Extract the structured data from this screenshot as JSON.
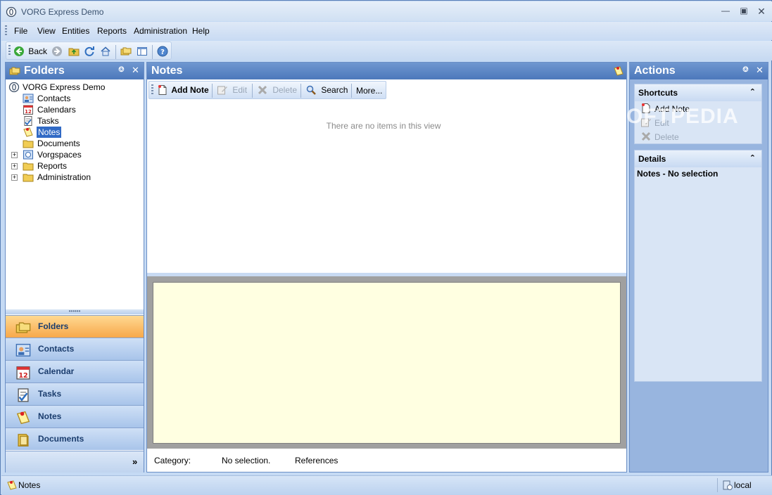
{
  "window": {
    "title": "VORG Express Demo",
    "controls": [
      "minimize",
      "maximize",
      "close"
    ]
  },
  "menu": {
    "items": [
      "File",
      "View",
      "Entities",
      "Reports",
      "Administration",
      "Help"
    ]
  },
  "toolbar": {
    "back_label": "Back",
    "icons": [
      "back-icon",
      "forward-icon",
      "folder-up-icon",
      "refresh-icon",
      "home-icon",
      "folders-icon",
      "layout-icon",
      "help-icon"
    ]
  },
  "folders": {
    "title": "Folders",
    "tree": {
      "root": "VORG Express Demo",
      "items": [
        {
          "label": "Contacts",
          "icon": "contacts-icon",
          "expandable": false
        },
        {
          "label": "Calendars",
          "icon": "calendar-icon",
          "expandable": false
        },
        {
          "label": "Tasks",
          "icon": "tasks-icon",
          "expandable": false
        },
        {
          "label": "Notes",
          "icon": "notes-icon",
          "expandable": false,
          "selected": true
        },
        {
          "label": "Documents",
          "icon": "folder-icon",
          "expandable": false
        },
        {
          "label": "Vorgspaces",
          "icon": "vorgspace-icon",
          "expandable": true
        },
        {
          "label": "Reports",
          "icon": "folder-icon",
          "expandable": true
        },
        {
          "label": "Administration",
          "icon": "folder-icon",
          "expandable": true
        }
      ]
    },
    "nav_buttons": [
      {
        "label": "Folders",
        "icon": "folders-icon",
        "active": true
      },
      {
        "label": "Contacts",
        "icon": "contacts-icon",
        "active": false
      },
      {
        "label": "Calendar",
        "icon": "calendar-icon",
        "active": false
      },
      {
        "label": "Tasks",
        "icon": "tasks-icon",
        "active": false
      },
      {
        "label": "Notes",
        "icon": "notes-icon",
        "active": false
      },
      {
        "label": "Documents",
        "icon": "documents-icon",
        "active": false
      }
    ],
    "more_glyph": "»"
  },
  "notes": {
    "title": "Notes",
    "toolbar": {
      "add_label": "Add Note",
      "edit_label": "Edit",
      "delete_label": "Delete",
      "search_label": "Search",
      "more_label": "More..."
    },
    "empty_message": "There are no items in this view",
    "footer": {
      "category_label": "Category:",
      "category_value": "No selection.",
      "references_label": "References"
    }
  },
  "actions": {
    "title": "Actions",
    "shortcuts": {
      "title": "Shortcuts",
      "items": [
        {
          "label": "Add Note",
          "enabled": true
        },
        {
          "label": "Edit",
          "enabled": false
        },
        {
          "label": "Delete",
          "enabled": false
        }
      ]
    },
    "details": {
      "title": "Details",
      "text": "Notes - No selection"
    }
  },
  "watermark": "SOFTPEDIA",
  "statusbar": {
    "left": "Notes",
    "right": "local"
  },
  "colors": {
    "header_blue": "#5c86c6",
    "active_nav": "#f9b454",
    "preview_bg": "#ffffe1",
    "selection": "#316ac5"
  }
}
